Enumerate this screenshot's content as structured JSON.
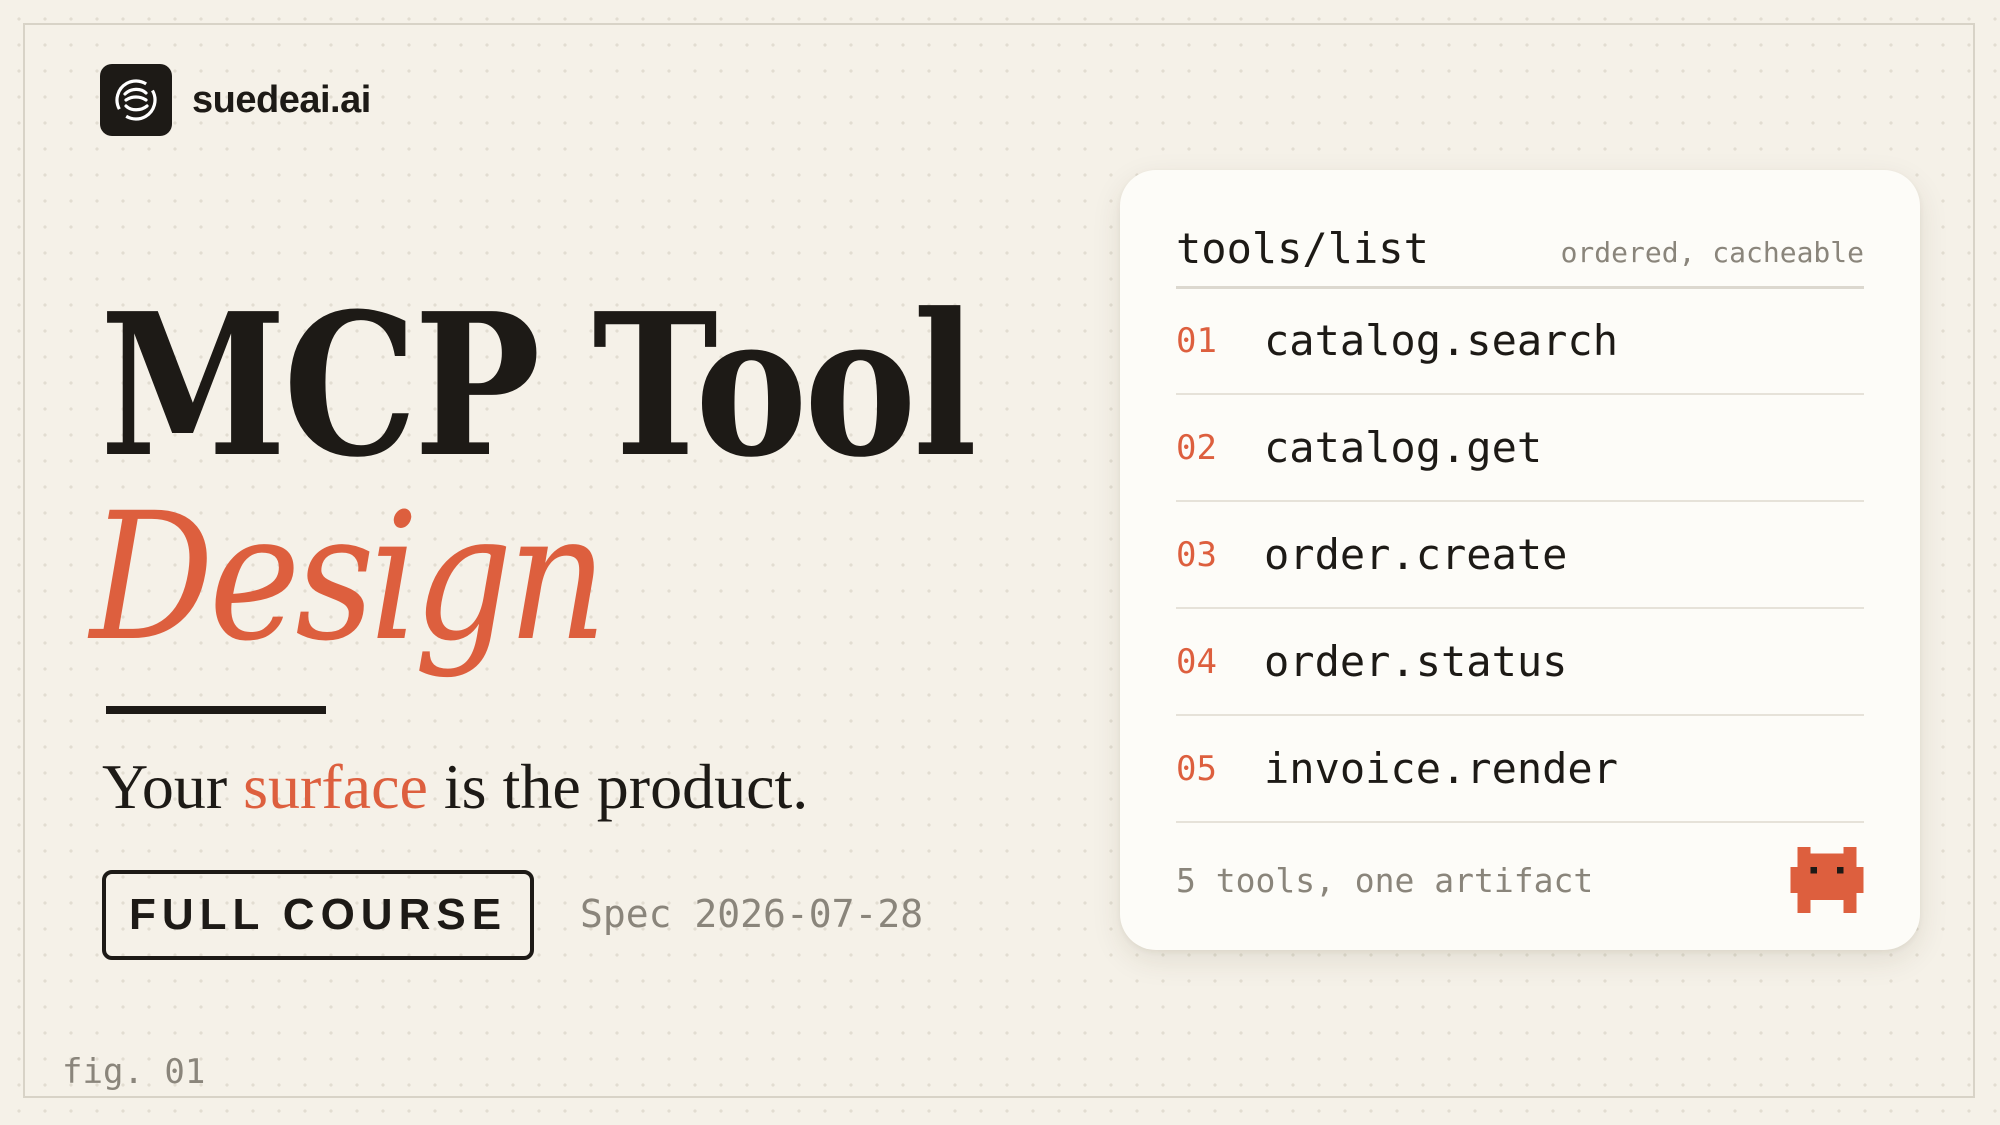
{
  "brand": {
    "name": "suedeai.ai",
    "icon": "swirl-logo-icon"
  },
  "hero": {
    "title_line1": "MCP Tool",
    "title_line2": "Design",
    "tagline": {
      "before": "Your ",
      "accent": "surface",
      "after": " is the product."
    }
  },
  "actions": {
    "course_label": "FULL COURSE",
    "spec_text": "Spec 2026-07-28"
  },
  "figure_label": "fig. 01",
  "card": {
    "title": "tools/list",
    "meta": "ordered, cacheable",
    "tools": [
      {
        "num": "01",
        "name": "catalog.search"
      },
      {
        "num": "02",
        "name": "catalog.get"
      },
      {
        "num": "03",
        "name": "order.create"
      },
      {
        "num": "04",
        "name": "order.status"
      },
      {
        "num": "05",
        "name": "invoice.render"
      }
    ],
    "footer": "5 tools, one artifact",
    "mascot_icon": "pixel-creature-icon"
  },
  "colors": {
    "background": "#f5f1e8",
    "accent": "#dd5f3e",
    "ink": "#1d1a16",
    "muted": "#8a857b",
    "card": "#fdfcf8"
  }
}
